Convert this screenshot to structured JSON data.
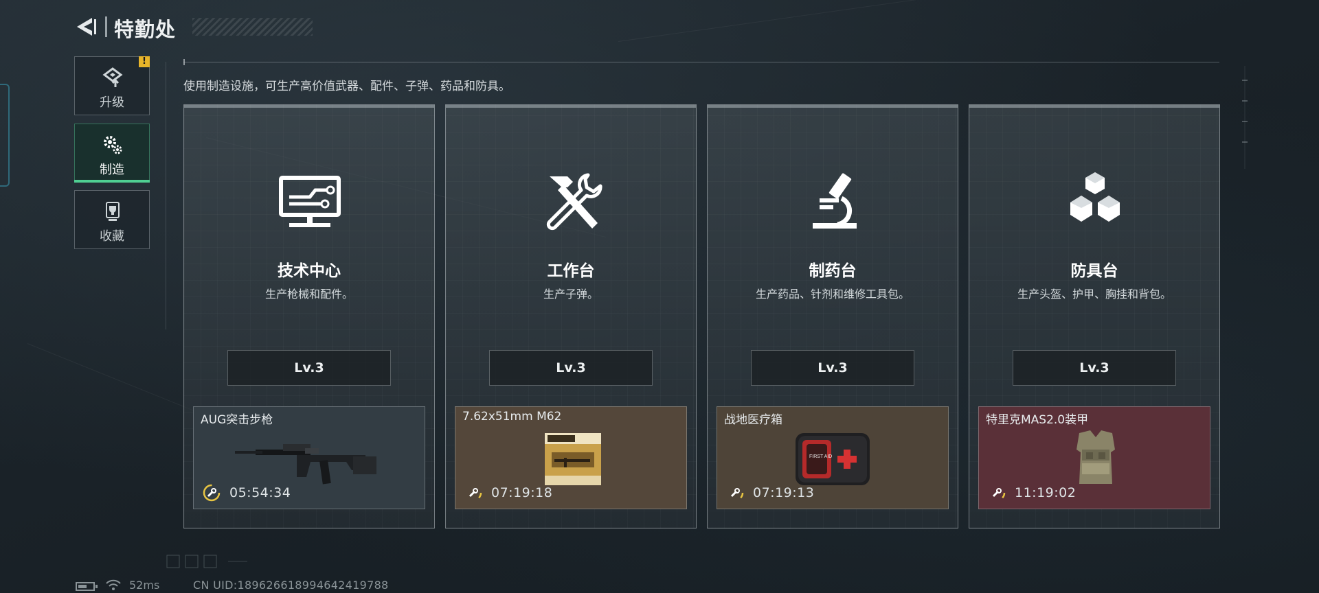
{
  "header": {
    "title": "特勤处"
  },
  "sidebar": {
    "tabs": [
      {
        "label": "升级",
        "icon": "upgrade-icon",
        "alert": "!"
      },
      {
        "label": "制造",
        "icon": "gears-icon",
        "active": true
      },
      {
        "label": "收藏",
        "icon": "trophy-icon"
      }
    ]
  },
  "main": {
    "description": "使用制造设施，可生产高价值武器、配件、子弹、药品和防具。",
    "cards": [
      {
        "title": "技术中心",
        "description": "生产枪械和配件。",
        "level": "Lv.3",
        "icon": "monitor-circuit-icon",
        "production": {
          "item": "AUG突击步枪",
          "time": "05:54:34",
          "image": "rifle-image",
          "timer_icon": "wrench-timer-icon"
        }
      },
      {
        "title": "工作台",
        "description": "生产子弹。",
        "level": "Lv.3",
        "icon": "hammer-wrench-icon",
        "production": {
          "item": "7.62x51mm M62",
          "time": "07:19:18",
          "image": "ammo-box-image",
          "timer_icon": "wrench-timer-icon"
        }
      },
      {
        "title": "制药台",
        "description": "生产药品、针剂和维修工具包。",
        "level": "Lv.3",
        "icon": "microscope-icon",
        "production": {
          "item": "战地医疗箱",
          "time": "07:19:13",
          "image": "first-aid-kit-image",
          "image_text": "FIRST AID",
          "timer_icon": "wrench-timer-icon"
        }
      },
      {
        "title": "防具台",
        "description": "生产头盔、护甲、胸挂和背包。",
        "level": "Lv.3",
        "icon": "cubes-icon",
        "production": {
          "item": "特里克MAS2.0装甲",
          "time": "11:19:02",
          "image": "body-armor-image",
          "timer_icon": "wrench-timer-icon"
        }
      }
    ]
  },
  "footer": {
    "ping": "52ms",
    "uid": "CN UID:18962661899464​2419788"
  },
  "colors": {
    "accent_green": "#4fcf92",
    "alert_yellow": "#e8b52a",
    "timer_yellow": "#e8c542",
    "prod_tech_bg": "#333d44",
    "prod_work_bg": "#54473a",
    "prod_med_bg": "#4e4438",
    "prod_armor_bg": "#5a3038"
  }
}
